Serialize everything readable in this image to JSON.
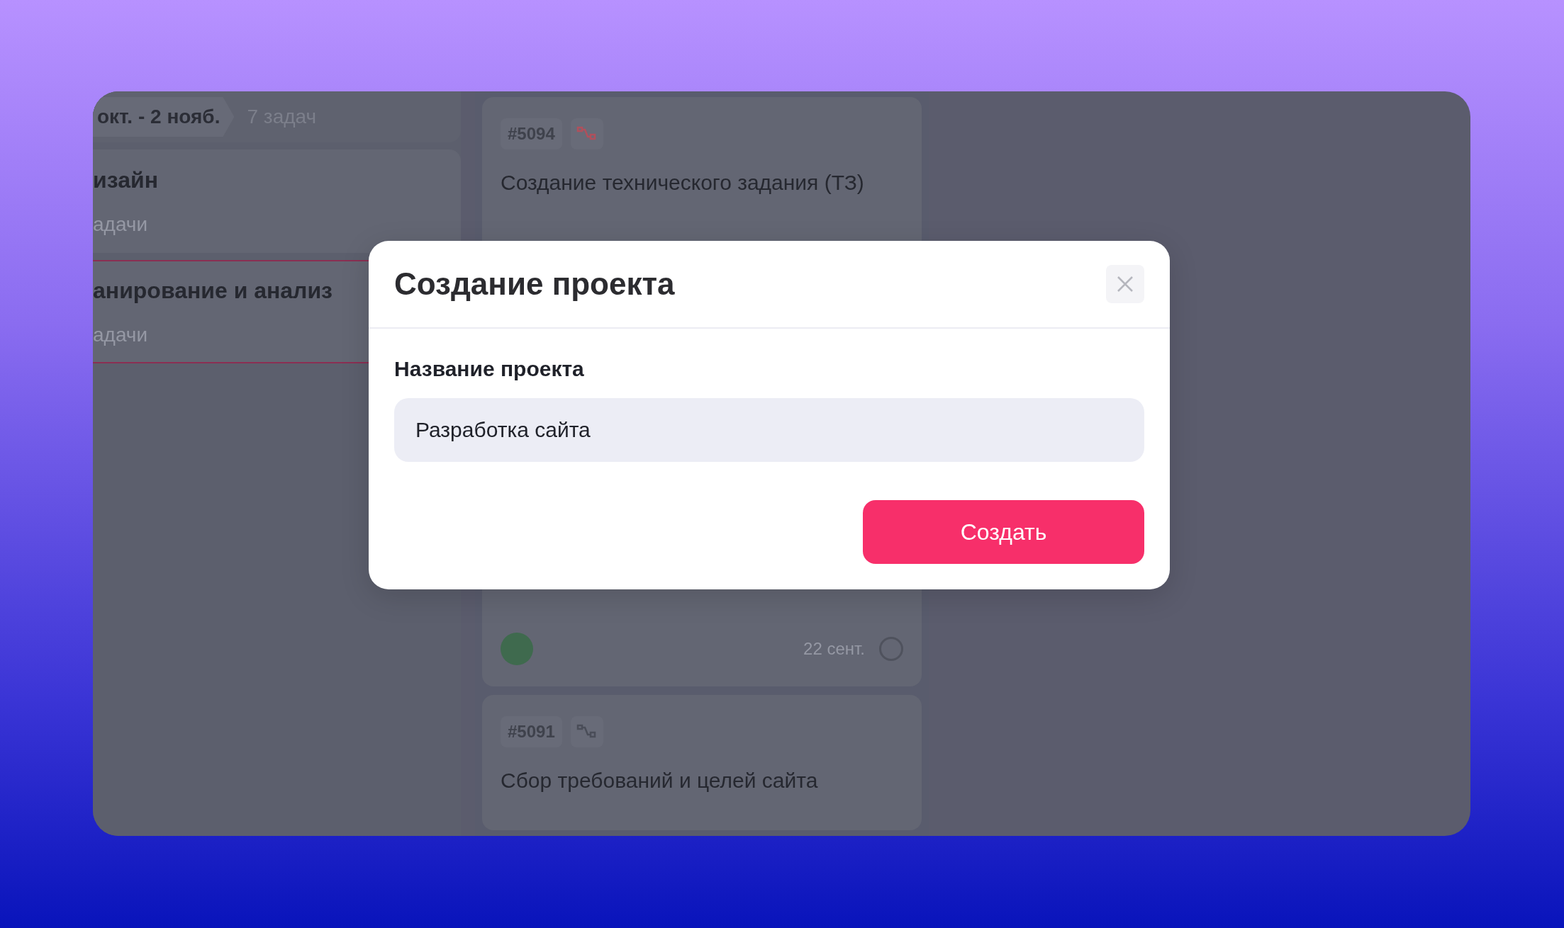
{
  "board": {
    "period": {
      "range": "окт. - 2 нояб.",
      "count": "7 задач"
    },
    "projects": [
      {
        "name": "изайн",
        "meta": "адачи",
        "selected": false
      },
      {
        "name": "анирование и анализ",
        "meta": "адачи",
        "selected": true
      }
    ],
    "tasks": [
      {
        "id": "#5094",
        "color": "#b0505c",
        "title": "Создание технического задания (ТЗ)"
      },
      {
        "date": "22 сент."
      },
      {
        "id": "#5091",
        "color": "#4a4d58",
        "title": "Сбор требований и целей сайта"
      }
    ]
  },
  "dialog": {
    "title": "Создание проекта",
    "field_label": "Название проекта",
    "field_value": "Разработка сайта",
    "submit": "Создать"
  }
}
